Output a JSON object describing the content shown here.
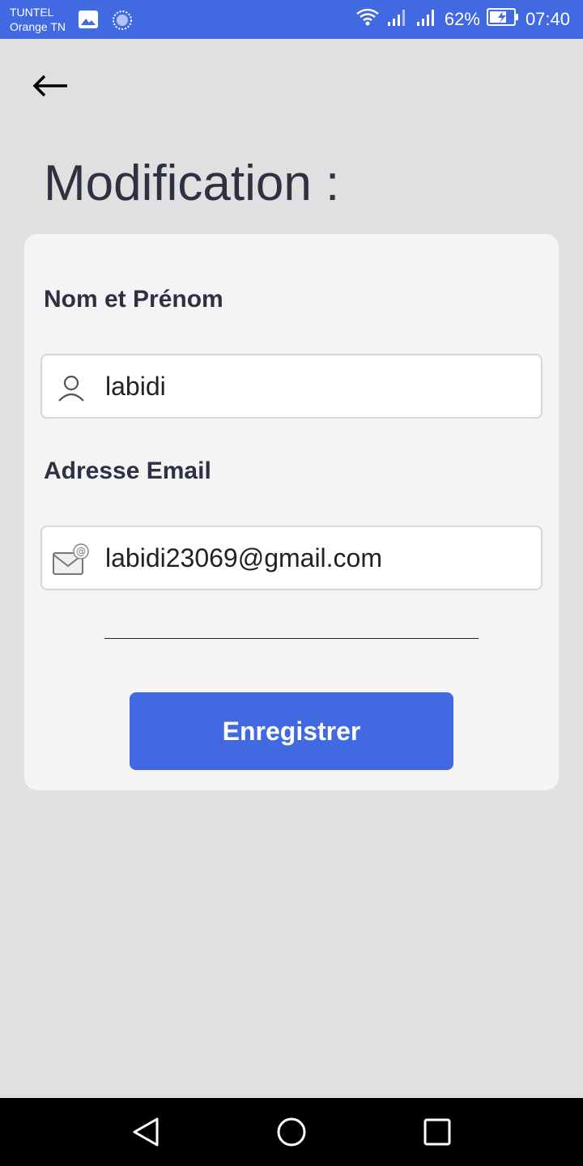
{
  "status_bar": {
    "carrier_line1": "TUNTEL",
    "carrier_line2": "Orange TN",
    "battery": "62%",
    "time": "07:40",
    "icons": [
      "gallery-icon",
      "sync-icon",
      "wifi-icon",
      "signal-icon",
      "signal-icon",
      "battery-charging-icon"
    ]
  },
  "header": {
    "back_icon": "arrow-left-icon",
    "title": "Modification :"
  },
  "form": {
    "name_label": "Nom et Prénom",
    "name_value": "labidi",
    "name_icon": "user-icon",
    "email_label": "Adresse Email",
    "email_value": "labidi23069@gmail.com",
    "email_icon": "mail-icon",
    "save_label": "Enregistrer"
  },
  "nav_bar": {
    "icons": [
      "back-triangle-icon",
      "home-circle-icon",
      "recents-square-icon"
    ]
  },
  "colors": {
    "accent": "#4169e1",
    "background": "#e0e0e0",
    "card": "#f4f4f4",
    "text_dark": "#2e3142"
  }
}
